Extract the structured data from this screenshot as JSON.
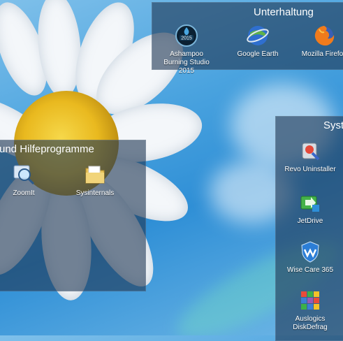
{
  "groups": {
    "entertainment": {
      "title": "Unterhaltung",
      "items": [
        {
          "label": "Ashampoo Burning Studio 2015",
          "icon": "burning-studio-icon",
          "badge": "2015"
        },
        {
          "label": "Google Earth",
          "icon": "google-earth-icon"
        },
        {
          "label": "Mozilla Firefox",
          "icon": "firefox-icon"
        }
      ]
    },
    "tools": {
      "title": "und Hilfeprogramme",
      "items": [
        {
          "label": "ZoomIt",
          "icon": "zoomit-icon"
        },
        {
          "label": "Sysinternals",
          "icon": "folder-icon"
        }
      ]
    },
    "system": {
      "title": "Syste",
      "items": [
        {
          "label": "Revo Uninstaller",
          "icon": "revo-uninstaller-icon"
        },
        {
          "label": "JetDrive",
          "icon": "jetdrive-icon"
        },
        {
          "label": "Wise Care 365",
          "icon": "wise-care-icon"
        },
        {
          "label": "Auslogics DiskDefrag",
          "icon": "auslogics-defrag-icon"
        }
      ]
    }
  }
}
